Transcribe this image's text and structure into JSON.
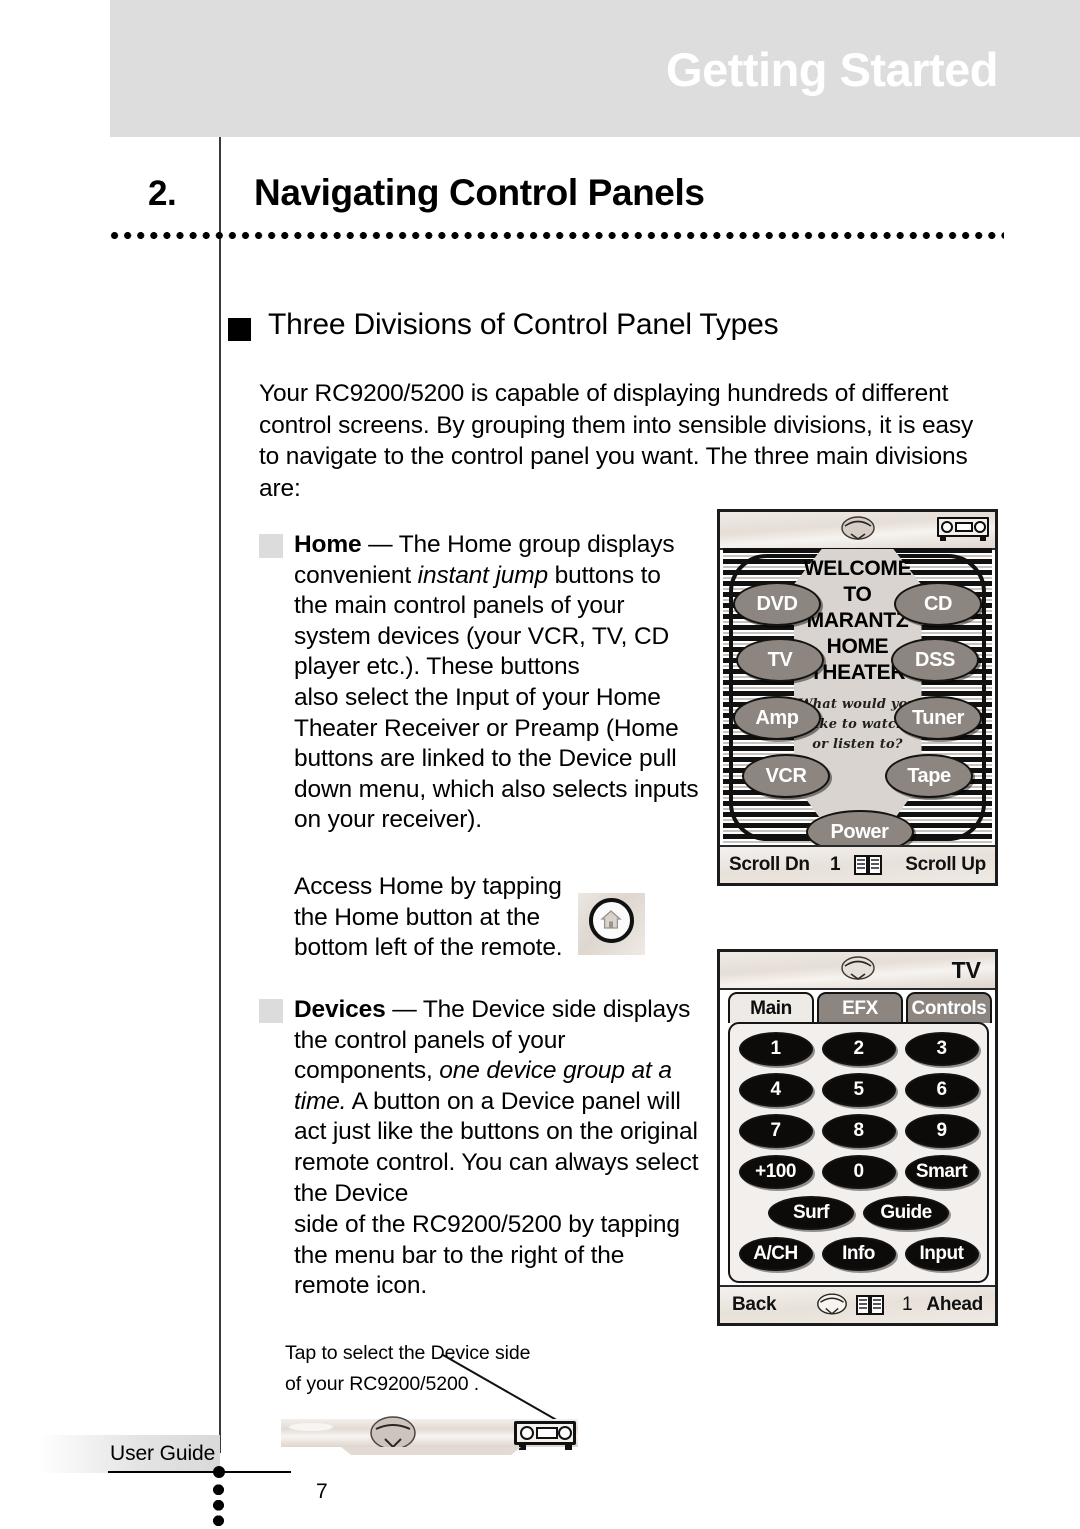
{
  "header": {
    "band_title": "Getting Started"
  },
  "chapter": {
    "number": "2.",
    "title": "Navigating Control Panels"
  },
  "section": {
    "title": "Three Divisions of Control Panel Types",
    "intro": "Your RC9200/5200 is capable of displaying hundreds of different control screens. By grouping them into sensible divisions, it is easy to navigate to the control panel you want. The three main divisions are:"
  },
  "bullets": {
    "home": {
      "term": "Home",
      "dash": " — ",
      "text_1": "The Home group displays convenient ",
      "italic_1": "instant jump",
      "text_2": " buttons to the main control panels of your system devices (your VCR, TV, CD player etc.). These buttons",
      "text_3": "also select the Input of your Home Theater Receiver or Preamp (Home buttons are linked to the Device pull down menu, which also selects inputs on your receiver)."
    },
    "access_home": "Access Home by tapping the Home button at the bottom left of the remote.",
    "devices": {
      "term": "Devices",
      "dash": " — ",
      "text_1": "The Device side displays the control panels of your components, ",
      "italic_1": "one device group at a time.",
      "text_2": "  A button on a Device panel will act just like the buttons on the original remote control. You can always select the Device",
      "text_3": "side of the RC9200/5200  by tapping the menu bar to the right of the remote icon."
    }
  },
  "caption": {
    "line1": "Tap to select the Device side",
    "line2": "of your RC9200/5200 ."
  },
  "welcome_panel": {
    "title_lines": [
      "WELCOME",
      "TO",
      "MARANTZ",
      "HOME",
      "THEATER"
    ],
    "script_lines": [
      "What would you",
      "like to watch",
      "or listen to?"
    ],
    "buttons_left": [
      "DVD",
      "TV",
      "Amp",
      "VCR"
    ],
    "buttons_right": [
      "CD",
      "DSS",
      "Tuner",
      "Tape"
    ],
    "button_power": "Power",
    "bottom_bar": {
      "left": "Scroll Dn",
      "page": "1",
      "right": "Scroll Up"
    },
    "icons": {
      "receiver": "receiver-icon",
      "dome": "dome-icon",
      "book": "book-icon"
    }
  },
  "tv_panel": {
    "device_label": "TV",
    "tabs": [
      {
        "label": "Main",
        "active": true
      },
      {
        "label": "EFX",
        "active": false
      },
      {
        "label": "Controls",
        "active": false
      }
    ],
    "keys": [
      [
        "1",
        "2",
        "3"
      ],
      [
        "4",
        "5",
        "6"
      ],
      [
        "7",
        "8",
        "9"
      ],
      [
        "+100",
        "0",
        "Smart"
      ],
      [
        "Surf",
        "Guide"
      ],
      [
        "A/CH",
        "Info",
        "Input"
      ]
    ],
    "bottom_bar": {
      "left": "Back",
      "page": "1",
      "right": "Ahead"
    },
    "icons": {
      "dome": "dome-icon",
      "book": "book-icon"
    }
  },
  "footer": {
    "label": "User Guide",
    "page_number": "7"
  },
  "colors": {
    "band_gray": "#dddddd",
    "oval_gray": "#8d857f",
    "plate_gray": "#d9d4cf",
    "key_black": "#0d0b0a",
    "bullet_square": "#dcdcdc"
  }
}
